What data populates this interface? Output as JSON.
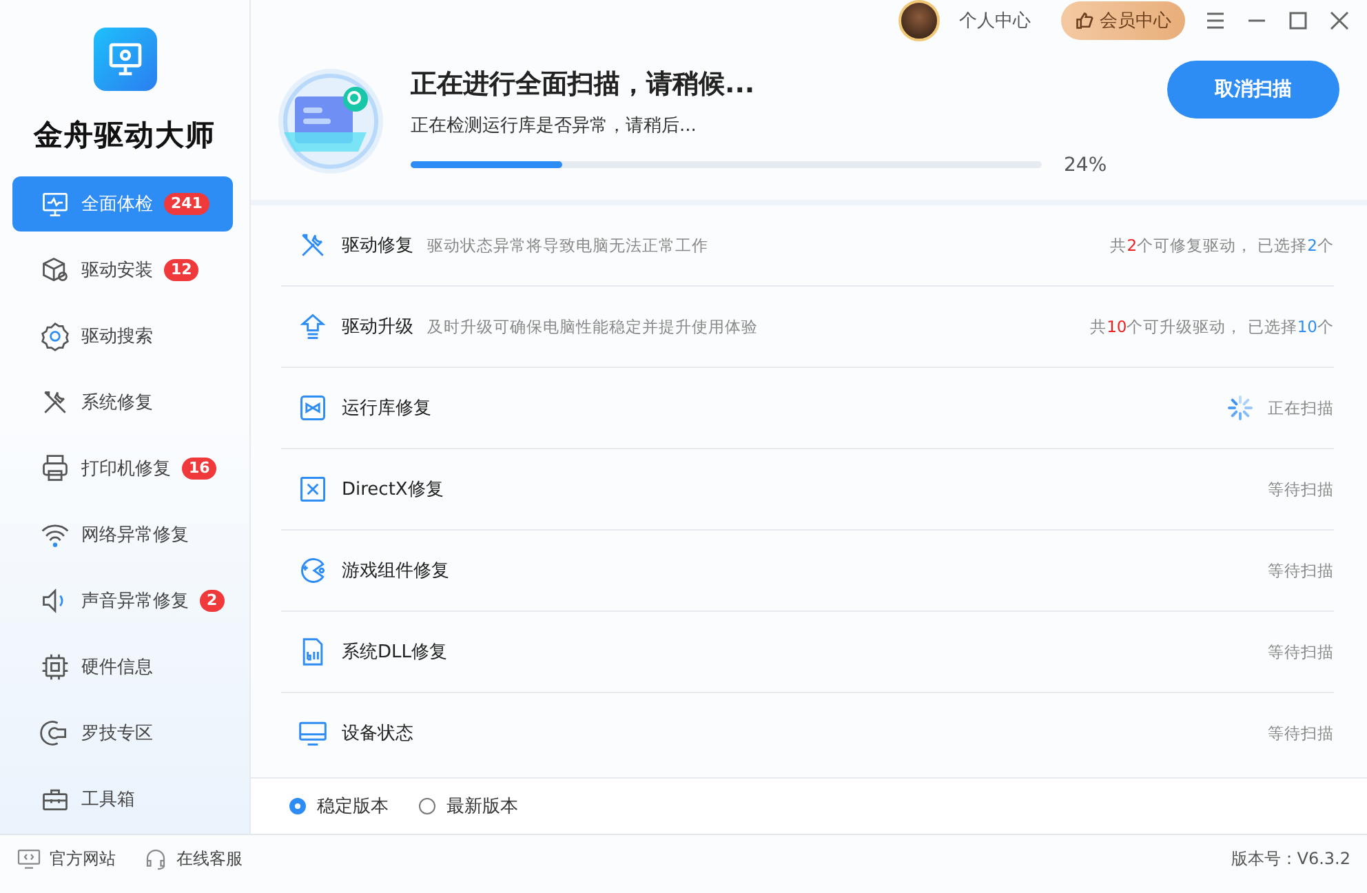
{
  "app": {
    "title": "金舟驱动大师"
  },
  "sidebar": {
    "items": [
      {
        "label": "全面体检",
        "badge": "241",
        "selected": true
      },
      {
        "label": "驱动安装",
        "badge": "12",
        "selected": false
      },
      {
        "label": "驱动搜索",
        "selected": false
      },
      {
        "label": "系统修复",
        "selected": false
      },
      {
        "label": "打印机修复",
        "badge": "16",
        "selected": false
      },
      {
        "label": "网络异常修复",
        "selected": false
      },
      {
        "label": "声音异常修复",
        "badge": "2",
        "selected": false
      },
      {
        "label": "硬件信息",
        "selected": false
      },
      {
        "label": "罗技专区",
        "selected": false
      },
      {
        "label": "工具箱",
        "selected": false
      }
    ]
  },
  "top_bar": {
    "profile": "个人中心",
    "vip": "会员中心"
  },
  "scan": {
    "title": "正在进行全面扫描，请稍候...",
    "subtitle": "正在检测运行库是否异常，请稍后...",
    "level": 0.24,
    "percent": "24%",
    "cancel": "取消扫描"
  },
  "checks": [
    {
      "name": "驱动修复",
      "description": "驱动状态异常将导致电脑无法正常工作",
      "status": {
        "kind": "counts",
        "parts": [
          {
            "text": "共"
          },
          {
            "text": "2",
            "color": "#f02020"
          },
          {
            "text": "个可修复驱动， 已选择"
          },
          {
            "text": "2",
            "color": "#2e8cf5"
          },
          {
            "text": "个"
          }
        ]
      }
    },
    {
      "name": "驱动升级",
      "description": "及时升级可确保电脑性能稳定并提升使用体验",
      "status": {
        "kind": "counts",
        "parts": [
          {
            "text": "共"
          },
          {
            "text": "10",
            "color": "#f02020"
          },
          {
            "text": "个可升级驱动， 已选择"
          },
          {
            "text": "10",
            "color": "#2e8cf5"
          },
          {
            "text": "个"
          }
        ]
      }
    },
    {
      "name": "运行库修复",
      "status": {
        "kind": "scanning",
        "text": "正在扫描"
      }
    },
    {
      "name": "DirectX修复",
      "status": {
        "kind": "waiting",
        "text": "等待扫描"
      }
    },
    {
      "name": "游戏组件修复",
      "status": {
        "kind": "waiting",
        "text": "等待扫描"
      }
    },
    {
      "name": "系统DLL修复",
      "status": {
        "kind": "waiting",
        "text": "等待扫描"
      }
    },
    {
      "name": "设备状态",
      "status": {
        "kind": "waiting",
        "text": "等待扫描"
      }
    }
  ],
  "versions": [
    {
      "label": "稳定版本",
      "selected": true
    },
    {
      "label": "最新版本",
      "selected": false
    }
  ],
  "footer": {
    "links": [
      "官方网站",
      "在线客服"
    ],
    "version": "版本号：V6.3.2"
  }
}
